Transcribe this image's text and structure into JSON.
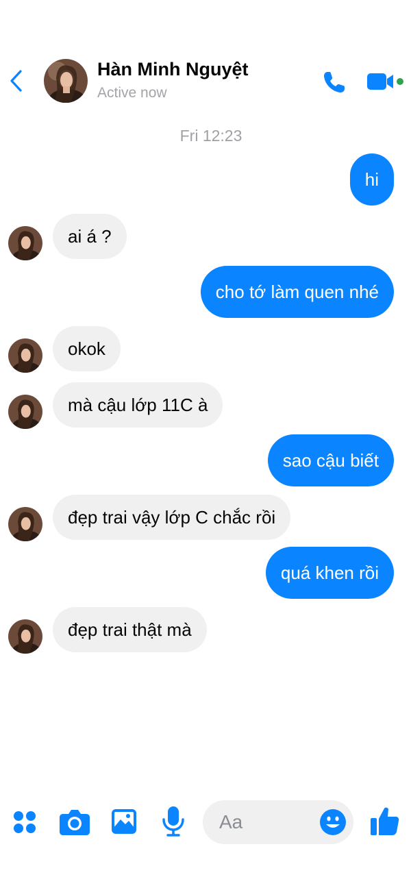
{
  "contact": {
    "name": "Hàn Minh Nguyệt",
    "status": "Active now"
  },
  "thread": {
    "timestamp": "Fri 12:23",
    "messages": [
      {
        "from": "me",
        "text": "hi"
      },
      {
        "from": "them",
        "text": "ai á ?"
      },
      {
        "from": "me",
        "text": "cho tớ làm quen nhé"
      },
      {
        "from": "them",
        "text": "okok"
      },
      {
        "from": "them",
        "text": "mà cậu lớp 11C à"
      },
      {
        "from": "me",
        "text": "sao cậu biết"
      },
      {
        "from": "them",
        "text": "đẹp trai vậy lớp C chắc rồi"
      },
      {
        "from": "me",
        "text": "quá khen rồi"
      },
      {
        "from": "them",
        "text": "đẹp trai thật mà"
      }
    ]
  },
  "composer": {
    "placeholder": "Aa",
    "icons": [
      "apps-icon",
      "camera-icon",
      "image-icon",
      "microphone-icon",
      "emoji-icon",
      "like-icon"
    ]
  },
  "header_icons": [
    "back-chevron-icon",
    "phone-call-icon",
    "video-call-icon"
  ],
  "colors": {
    "accent": "#0a84ff",
    "incoming_bubble": "#f0f0f0",
    "active_dot": "#31a24c",
    "muted_text": "#a3a3a8"
  }
}
